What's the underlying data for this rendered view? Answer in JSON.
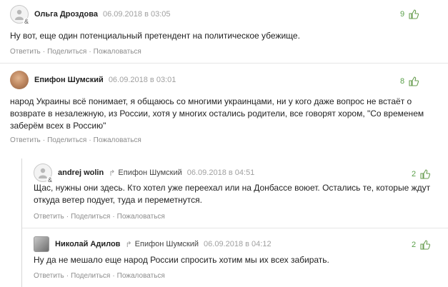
{
  "actions": {
    "reply": "Ответить",
    "share": "Поделиться",
    "report": "Пожаловаться",
    "separator": "·"
  },
  "reply_arrow": "↱",
  "comments": [
    {
      "author": "Ольга Дроздова",
      "date": "06.09.2018 в 03:05",
      "votes": "9",
      "text": "Ну вот, еще один потенциальный претендент на политическое убежище."
    },
    {
      "author": "Епифон Шумский",
      "date": "06.09.2018 в 03:01",
      "votes": "8",
      "text": "народ Украины всё понимает, я общаюсь со многими украинцами, ни у кого даже вопрос не встаёт о возврате в незалежную, из России, хотя у многих остались родители, все говорят хором, \"Со временем заберём всех в Россию\""
    },
    {
      "author": "andrej wolin",
      "reply_to": "Епифон Шумский",
      "date": "06.09.2018 в 04:51",
      "votes": "2",
      "text": "Щас, нужны они здесь. Кто хотел уже переехал или на Донбассе воюет. Остались те, которые ждут откуда ветер подует, туда и переметнутся."
    },
    {
      "author": "Николай Адилов",
      "reply_to": "Епифон Шумский",
      "date": "06.09.2018 в 04:12",
      "votes": "2",
      "text": "Ну да не мешало еще народ России спросить хотим мы их всех забирать."
    }
  ],
  "colors": {
    "vote_positive": "#5aa04a",
    "muted": "#a0a0a0",
    "action": "#8c8c8c"
  }
}
